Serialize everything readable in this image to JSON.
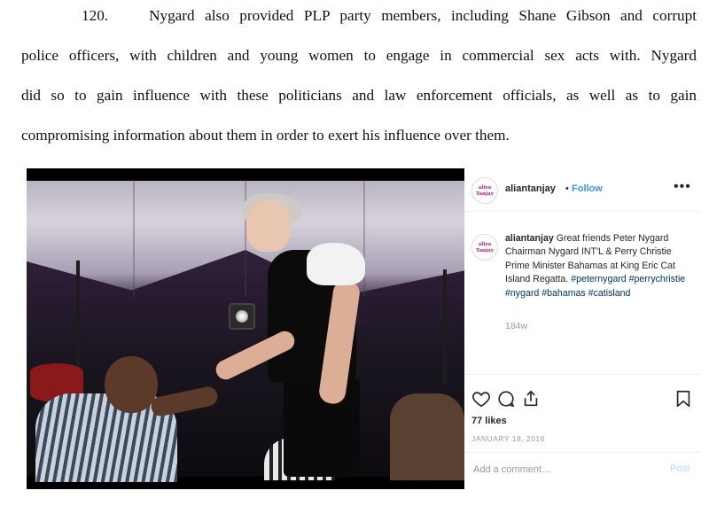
{
  "document": {
    "paragraph_number": "120.",
    "line1": "Nygard also provided PLP party members, including Shane Gibson and corrupt",
    "line2": "police officers, with children and young women to engage in commercial sex acts with.  Nygard",
    "line3": "did so to gain influence with these politicians and law enforcement officials, as well as to gain",
    "line4": "compromising information about them in order to exert his influence over them."
  },
  "post": {
    "avatar_text_top": "aliya",
    "avatar_text_bottom": "Tanjay",
    "username": "aliantanjay",
    "separator": "•",
    "follow_label": "Follow",
    "more_icon": "more-horizontal-icon",
    "caption_user": "aliantanjay",
    "caption_text": "Great friends Peter Nygard Chairman Nygard INT'L & Perry Christie Prime Minister Bahamas at King Eric Cat Island Regatta.",
    "hashtags": [
      "#peternygard",
      "#perrychristie",
      "#nygard",
      "#bahamas",
      "#catisland"
    ],
    "age": "184w",
    "likes": "77 likes",
    "date": "JANUARY 18, 2016",
    "comment_placeholder": "Add a comment…",
    "post_label": "Post",
    "icons": [
      "heart-icon",
      "comment-icon",
      "share-icon",
      "bookmark-icon"
    ]
  }
}
